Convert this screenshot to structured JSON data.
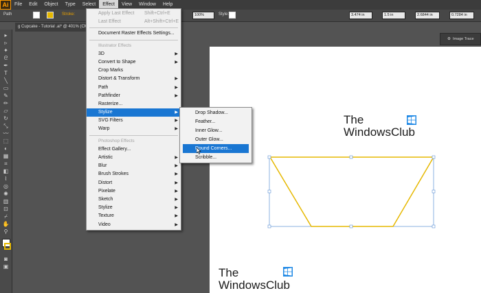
{
  "app": {
    "logo": "Ai"
  },
  "menubar": {
    "items": [
      "File",
      "Edit",
      "Object",
      "Type",
      "Select",
      "Effect",
      "View",
      "Window",
      "Help"
    ],
    "active": "Effect"
  },
  "control_bar": {
    "object_type": "Path",
    "stroke_label": "Stroke:",
    "opacity_value": "100%",
    "style_label": "Style:",
    "w_value": "3.474 in",
    "h_value": "1.5 in",
    "x_value": "2.6844 in",
    "y_value": "0.7284 in"
  },
  "document_tab": {
    "title": "g Cupcake - Tutorial .ai* @ 401% (CMYK/..."
  },
  "panel": {
    "image_trace_label": "Image Trace"
  },
  "effect_menu": {
    "apply_last": {
      "label": "Apply Last Effect",
      "shortcut": "Shift+Ctrl+E"
    },
    "last_effect": {
      "label": "Last Effect",
      "shortcut": "Alt+Shift+Ctrl+E"
    },
    "doc_raster_settings": "Document Raster Effects Settings...",
    "illustrator_header": "Illustrator Effects",
    "illustrator_items": [
      "3D",
      "Convert to Shape",
      "Crop Marks",
      "Distort & Transform",
      "Path",
      "Pathfinder",
      "Rasterize...",
      "Stylize",
      "SVG Filters",
      "Warp"
    ],
    "photoshop_header": "Photoshop Effects",
    "photoshop_items": [
      "Effect Gallery...",
      "Artistic",
      "Blur",
      "Brush Strokes",
      "Distort",
      "Pixelate",
      "Sketch",
      "Stylize",
      "Texture",
      "Video"
    ]
  },
  "stylize_submenu": {
    "items": [
      "Drop Shadow...",
      "Feather...",
      "Inner Glow...",
      "Outer Glow...",
      "Round Corners...",
      "Scribble..."
    ],
    "highlighted": "Round Corners..."
  },
  "watermark": {
    "line1": "The",
    "line2": "WindowsClub"
  },
  "colors": {
    "highlight": "#1976d2",
    "artboard": "#ffffff",
    "canvas": "#535353",
    "shape_stroke": "#e6b800",
    "bbox": "#5b8fd4"
  }
}
